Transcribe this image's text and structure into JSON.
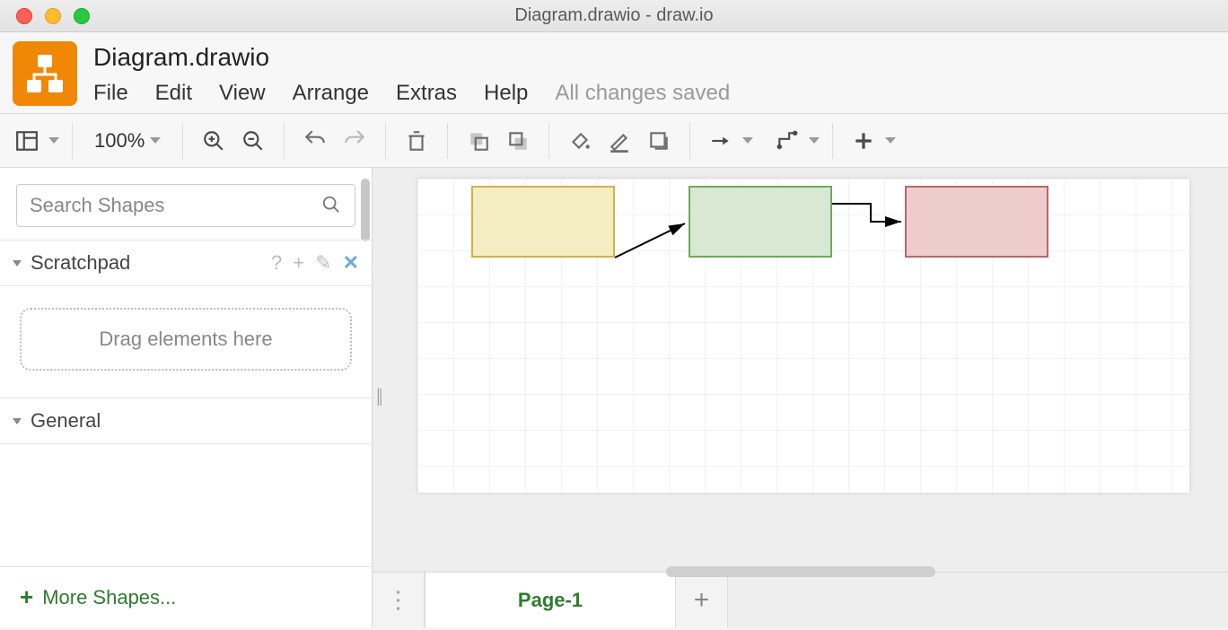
{
  "window": {
    "title": "Diagram.drawio - draw.io"
  },
  "header": {
    "doc_title": "Diagram.drawio",
    "menu": [
      "File",
      "Edit",
      "View",
      "Arrange",
      "Extras",
      "Help"
    ],
    "status": "All changes saved"
  },
  "toolbar": {
    "zoom": "100%"
  },
  "sidebar": {
    "search_placeholder": "Search Shapes",
    "scratchpad": {
      "title": "Scratchpad",
      "drop_hint": "Drag elements here"
    },
    "general": {
      "title": "General"
    },
    "more_shapes": "More Shapes..."
  },
  "tabs": {
    "active": "Page-1"
  },
  "canvas": {
    "nodes": [
      {
        "id": "n1",
        "color": "yellow"
      },
      {
        "id": "n2",
        "color": "green"
      },
      {
        "id": "n3",
        "color": "red"
      }
    ],
    "edges": [
      {
        "from": "n1",
        "to": "n2",
        "style": "diagonal"
      },
      {
        "from": "n2",
        "to": "n3",
        "style": "orthogonal"
      }
    ]
  }
}
